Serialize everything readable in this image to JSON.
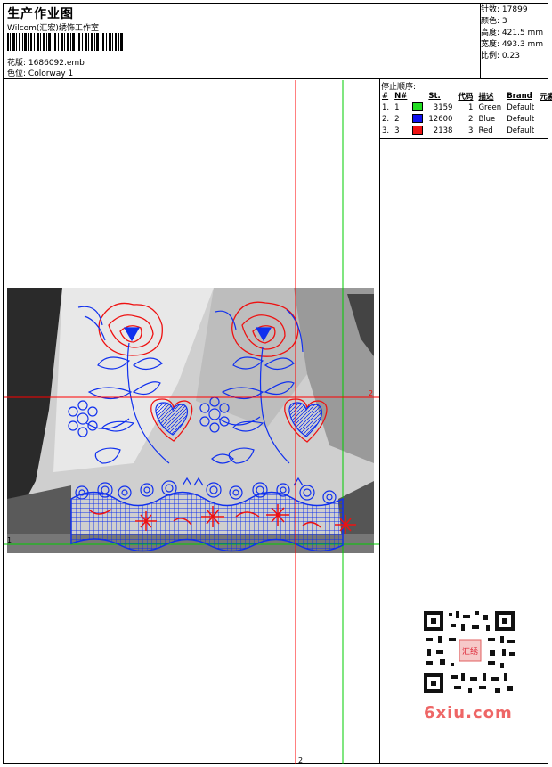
{
  "header": {
    "title": "生产作业图",
    "company": "Wilcom(汇宏)绣饰工作室",
    "design_label": "花版:",
    "design_value": "1686092.emb",
    "colorway_label": "色位:",
    "colorway_value": "Colorway 1"
  },
  "stats": [
    {
      "label": "针数:",
      "value": "17899"
    },
    {
      "label": "颜色:",
      "value": "3"
    },
    {
      "label": "高度:",
      "value": "421.5 mm"
    },
    {
      "label": "宽度:",
      "value": "493.3 mm"
    },
    {
      "label": "比例:",
      "value": "0.23"
    }
  ],
  "stop_sequence": {
    "title": "停止顺序:",
    "columns": [
      "#",
      "N#",
      "St.",
      "代码",
      "描述",
      "Brand",
      "元素"
    ],
    "rows": [
      {
        "idx": "1.",
        "n": "1",
        "color": "#22dd22",
        "st": "3159",
        "code": "1",
        "desc": "Green",
        "brand": "Default"
      },
      {
        "idx": "2.",
        "n": "2",
        "color": "#1010ee",
        "st": "12600",
        "code": "2",
        "desc": "Blue",
        "brand": "Default"
      },
      {
        "idx": "3.",
        "n": "3",
        "color": "#ee1111",
        "st": "2138",
        "code": "3",
        "desc": "Red",
        "brand": "Default"
      }
    ]
  },
  "markers": {
    "left_one": "1",
    "right_two": "2",
    "bottom_two": "2"
  },
  "watermark": {
    "site": "6xiu.com",
    "seal": "汇绣"
  },
  "colors": {
    "red_guide": "#ff0000",
    "green_guide": "#00cc00",
    "embroidery_blue": "#1030ee",
    "embroidery_red": "#ee1111"
  }
}
